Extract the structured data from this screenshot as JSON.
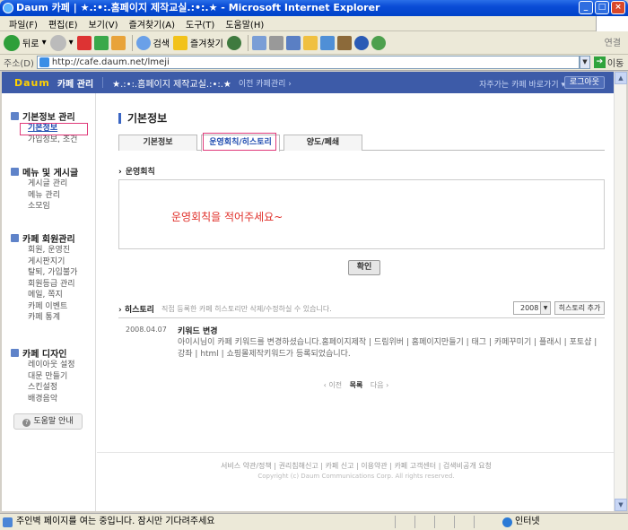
{
  "window": {
    "title": "Daum 카페 | ★.:•:.홈페이지 제작교실.:•:.★ - Microsoft Internet Explorer"
  },
  "menu": [
    "파일(F)",
    "편집(E)",
    "보기(V)",
    "즐겨찾기(A)",
    "도구(T)",
    "도움말(H)"
  ],
  "toolbar": {
    "back": "뒤로",
    "search": "검색",
    "favorites": "즐겨찾기",
    "connect": "연결"
  },
  "address": {
    "label": "주소(D)",
    "url": "http://cafe.daum.net/lmeji",
    "go": "이동"
  },
  "cafe": {
    "logo": "Daum",
    "admin_title": "카페 관리",
    "cafe_name": "★.:•:.홈페이지 제작교실.:•:.★",
    "prev_admin": "이전 카페관리 ›",
    "quick_menu": "자주가는 카페 바로가기 ▾",
    "logout": "로그아웃"
  },
  "sidebar": {
    "groups": [
      {
        "title": "기본정보 관리",
        "items": [
          "기본정보",
          "가입정보, 조건"
        ]
      },
      {
        "title": "메뉴 및 게시글",
        "items": [
          "게시글 관리",
          "메뉴 관리",
          "소모임"
        ]
      },
      {
        "title": "카페 회원관리",
        "items": [
          "회원, 운영진",
          "게시판지기",
          "탈퇴, 가입불가",
          "회원등급 관리",
          "메일, 쪽지",
          "카페 이벤트",
          "카페 통계"
        ]
      },
      {
        "title": "카페 디자인",
        "items": [
          "레이아웃 설정",
          "대문 만들기",
          "스킨설정",
          "배경음악"
        ]
      }
    ],
    "help": "도움말 안내"
  },
  "main": {
    "page_title": "기본정보",
    "tabs": [
      "기본정보",
      "운영회칙/히스토리",
      "양도/폐쇄"
    ],
    "rules_header": "운영회칙",
    "rules_text": "운영회칙을 적어주세요~",
    "confirm": "확인",
    "history": {
      "header": "히스토리",
      "desc": "직접 등록한 카페 히스토리만 삭제/수정하실 수 있습니다.",
      "year": "2008",
      "add": "히스토리 추가",
      "date": "2008.04.07",
      "entry_title": "키워드 변경",
      "entry_text": "아이시님이 카페 키워드를 변경하셨습니다.홈페이지제작 | 드림위버 | 홈페이지만들기 | 태그 | 카페꾸미기 | 플래시 | 포토샵 | 강좌 | html | 쇼핑몰제작키워드가 등록되었습니다."
    },
    "pager": {
      "prev": "‹ 이전",
      "list": "목록",
      "next": "다음 ›"
    },
    "footer_links": "서비스 약관/정책 | 권리침해신고 | 카페 신고 | 이용약관 | 카페 고객센터 | 검색비공개 요청",
    "copyright": "Copyright (c) Daum Communications Corp. All rights reserved."
  },
  "status": {
    "text": "주인벽 페이지를 여는 중입니다. 잠시만 기다려주세요",
    "zone": "인터넷"
  }
}
